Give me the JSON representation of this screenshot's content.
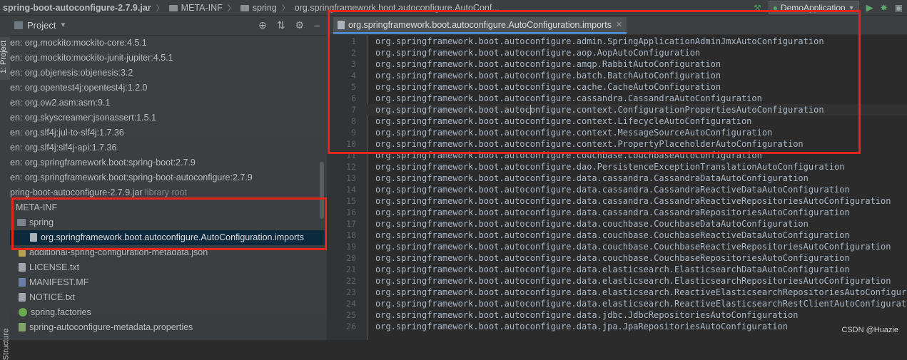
{
  "breadcrumb": {
    "items": [
      "spring-boot-autoconfigure-2.7.9.jar",
      "META-INF",
      "spring",
      "org.springframework.boot.autoconfigure.AutoConf..."
    ]
  },
  "toolbar": {
    "run_config": "DemoApplication"
  },
  "stripe": {
    "project_label": "1: Project",
    "structure_label": "Structure"
  },
  "project_panel": {
    "title": "Project",
    "rows": [
      "en: org.mockito:mockito-core:4.5.1",
      "en: org.mockito:mockito-junit-jupiter:4.5.1",
      "en: org.objenesis:objenesis:3.2",
      "en: org.opentest4j:opentest4j:1.2.0",
      "en: org.ow2.asm:asm:9.1",
      "en: org.skyscreamer:jsonassert:1.5.1",
      "en: org.slf4j:jul-to-slf4j:1.7.36",
      "en: org.slf4j:slf4j-api:1.7.36",
      "en: org.springframework.boot:spring-boot:2.7.9",
      "en: org.springframework.boot:spring-boot-autoconfigure:2.7.9"
    ],
    "library_root_name": "pring-boot-autoconfigure-2.7.9.jar",
    "library_root_suffix": "library root",
    "meta_inf": "META-INF",
    "spring_folder": "spring",
    "imports_file": "org.springframework.boot.autoconfigure.AutoConfiguration.imports",
    "files": [
      "additional-spring-configuration-metadata.json",
      "LICENSE.txt",
      "MANIFEST.MF",
      "NOTICE.txt",
      "spring.factories",
      "spring-autoconfigure-metadata.properties"
    ]
  },
  "editor": {
    "tab_title": "org.springframework.boot.autoconfigure.AutoConfiguration.imports",
    "lines": [
      "org.springframework.boot.autoconfigure.admin.SpringApplicationAdminJmxAutoConfiguration",
      "org.springframework.boot.autoconfigure.aop.AopAutoConfiguration",
      "org.springframework.boot.autoconfigure.amqp.RabbitAutoConfiguration",
      "org.springframework.boot.autoconfigure.batch.BatchAutoConfiguration",
      "org.springframework.boot.autoconfigure.cache.CacheAutoConfiguration",
      "org.springframework.boot.autoconfigure.cassandra.CassandraAutoConfiguration",
      "org.springframework.boot.autoconfigure.context.ConfigurationPropertiesAutoConfiguration",
      "org.springframework.boot.autoconfigure.context.LifecycleAutoConfiguration",
      "org.springframework.boot.autoconfigure.context.MessageSourceAutoConfiguration",
      "org.springframework.boot.autoconfigure.context.PropertyPlaceholderAutoConfiguration",
      "org.springframework.boot.autoconfigure.couchbase.CouchbaseAutoConfiguration",
      "org.springframework.boot.autoconfigure.dao.PersistenceExceptionTranslationAutoConfiguration",
      "org.springframework.boot.autoconfigure.data.cassandra.CassandraDataAutoConfiguration",
      "org.springframework.boot.autoconfigure.data.cassandra.CassandraReactiveDataAutoConfiguration",
      "org.springframework.boot.autoconfigure.data.cassandra.CassandraReactiveRepositoriesAutoConfiguration",
      "org.springframework.boot.autoconfigure.data.cassandra.CassandraRepositoriesAutoConfiguration",
      "org.springframework.boot.autoconfigure.data.couchbase.CouchbaseDataAutoConfiguration",
      "org.springframework.boot.autoconfigure.data.couchbase.CouchbaseReactiveDataAutoConfiguration",
      "org.springframework.boot.autoconfigure.data.couchbase.CouchbaseReactiveRepositoriesAutoConfiguration",
      "org.springframework.boot.autoconfigure.data.couchbase.CouchbaseRepositoriesAutoConfiguration",
      "org.springframework.boot.autoconfigure.data.elasticsearch.ElasticsearchDataAutoConfiguration",
      "org.springframework.boot.autoconfigure.data.elasticsearch.ElasticsearchRepositoriesAutoConfiguration",
      "org.springframework.boot.autoconfigure.data.elasticsearch.ReactiveElasticsearchRepositoriesAutoConfiguratio",
      "org.springframework.boot.autoconfigure.data.elasticsearch.ReactiveElasticsearchRestClientAutoConfiguration",
      "org.springframework.boot.autoconfigure.data.jdbc.JdbcRepositoriesAutoConfiguration",
      "org.springframework.boot.autoconfigure.data.jpa.JpaRepositoriesAutoConfiguration"
    ]
  },
  "watermark": "CSDN @Huazie",
  "colors": {
    "highlight_red": "#e4261d",
    "selection": "#0d293e",
    "code_text": "#a9b7c6"
  }
}
